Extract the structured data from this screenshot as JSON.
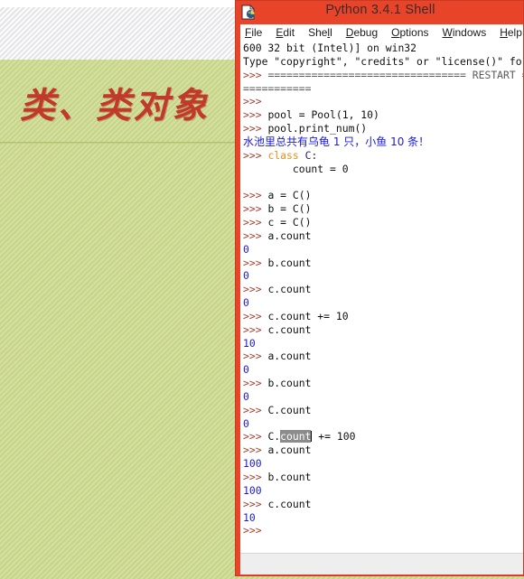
{
  "slide": {
    "title": "类、类对象",
    "title_color": "#c0392b",
    "background_color": "#ccd98e",
    "topband_color": "#efeff1"
  },
  "window": {
    "title": "Python 3.4.1 Shell",
    "accent_color": "#e8442a",
    "icon": "python-idle-icon",
    "menu": [
      {
        "label_before": "",
        "mnemonic": "F",
        "label_after": "ile"
      },
      {
        "label_before": "",
        "mnemonic": "E",
        "label_after": "dit"
      },
      {
        "label_before": "She",
        "mnemonic": "l",
        "label_after": "l"
      },
      {
        "label_before": "",
        "mnemonic": "D",
        "label_after": "ebug"
      },
      {
        "label_before": "",
        "mnemonic": "O",
        "label_after": "ptions"
      },
      {
        "label_before": "",
        "mnemonic": "W",
        "label_after": "indows"
      },
      {
        "label_before": "",
        "mnemonic": "H",
        "label_after": "elp"
      }
    ]
  },
  "shell": {
    "lines": [
      {
        "type": "plain",
        "text": "600 32 bit (Intel)] on win32"
      },
      {
        "type": "plain",
        "text": "Type \"copyright\", \"credits\" or \"license()\" for more"
      },
      {
        "type": "restart",
        "prompt": ">>> ",
        "text": "================================ RESTART ======"
      },
      {
        "type": "restart",
        "text": "==========="
      },
      {
        "type": "prompt",
        "prompt": ">>> ",
        "text": ""
      },
      {
        "type": "input",
        "prompt": ">>> ",
        "text": "pool = Pool(1, 10)"
      },
      {
        "type": "input",
        "prompt": ">>> ",
        "text": "pool.print_num()"
      },
      {
        "type": "cnout",
        "text": "水池里总共有乌龟 1 只，小鱼 10 条！"
      },
      {
        "type": "classdef",
        "prompt": ">>> ",
        "keyword": "class",
        "rest": " C:"
      },
      {
        "type": "indent",
        "text": "        count = 0"
      },
      {
        "type": "blank",
        "text": ""
      },
      {
        "type": "input",
        "prompt": ">>> ",
        "text": "a = C()"
      },
      {
        "type": "input",
        "prompt": ">>> ",
        "text": "b = C()"
      },
      {
        "type": "input",
        "prompt": ">>> ",
        "text": "c = C()"
      },
      {
        "type": "input",
        "prompt": ">>> ",
        "text": "a.count"
      },
      {
        "type": "output",
        "text": "0"
      },
      {
        "type": "input",
        "prompt": ">>> ",
        "text": "b.count"
      },
      {
        "type": "output",
        "text": "0"
      },
      {
        "type": "input",
        "prompt": ">>> ",
        "text": "c.count"
      },
      {
        "type": "output",
        "text": "0"
      },
      {
        "type": "input",
        "prompt": ">>> ",
        "text": "c.count += 10"
      },
      {
        "type": "input",
        "prompt": ">>> ",
        "text": "c.count"
      },
      {
        "type": "output",
        "text": "10"
      },
      {
        "type": "input",
        "prompt": ">>> ",
        "text": "a.count"
      },
      {
        "type": "output",
        "text": "0"
      },
      {
        "type": "input",
        "prompt": ">>> ",
        "text": "b.count"
      },
      {
        "type": "output",
        "text": "0"
      },
      {
        "type": "input",
        "prompt": ">>> ",
        "text": "C.count"
      },
      {
        "type": "output",
        "text": "0"
      },
      {
        "type": "selected",
        "prompt": ">>> ",
        "before": "C.",
        "selection": "count",
        "after": " += 100"
      },
      {
        "type": "input",
        "prompt": ">>> ",
        "text": "a.count"
      },
      {
        "type": "output",
        "text": "100"
      },
      {
        "type": "input",
        "prompt": ">>> ",
        "text": "b.count"
      },
      {
        "type": "output",
        "text": "100"
      },
      {
        "type": "input",
        "prompt": ">>> ",
        "text": "c.count"
      },
      {
        "type": "output",
        "text": "10"
      },
      {
        "type": "prompt",
        "prompt": ">>> ",
        "text": ""
      }
    ]
  }
}
